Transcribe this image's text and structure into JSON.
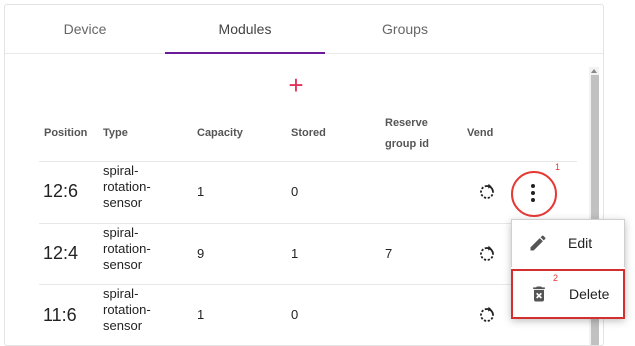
{
  "tabs": [
    {
      "label": "Device"
    },
    {
      "label": "Modules"
    },
    {
      "label": "Groups"
    }
  ],
  "add_button": {
    "label": "+",
    "color": "#e2335a"
  },
  "columns": {
    "position": "Position",
    "type": "Type",
    "capacity": "Capacity",
    "stored": "Stored",
    "reserve_group_id_line1": "Reserve",
    "reserve_group_id_line2": "group id",
    "vend": "Vend"
  },
  "rows": [
    {
      "position": "12:6",
      "type_line1": "spiral-",
      "type_line2": "rotation-",
      "type_line3": "sensor",
      "capacity": "1",
      "stored": "0",
      "reserve_group_id": ""
    },
    {
      "position": "12:4",
      "type_line1": "spiral-",
      "type_line2": "rotation-",
      "type_line3": "sensor",
      "capacity": "9",
      "stored": "1",
      "reserve_group_id": "7"
    },
    {
      "position": "11:6",
      "type_line1": "spiral-",
      "type_line2": "rotation-",
      "type_line3": "sensor",
      "capacity": "1",
      "stored": "0",
      "reserve_group_id": ""
    }
  ],
  "annotations": {
    "first": "1",
    "second": "2",
    "color": "#e53935"
  },
  "context_menu": {
    "edit_label": "Edit",
    "delete_label": "Delete"
  },
  "icons": {
    "vend": "rotate-icon",
    "more": "more-vertical-icon",
    "edit": "pencil-icon",
    "delete": "trash-icon"
  },
  "accent": "#6a1b9a"
}
